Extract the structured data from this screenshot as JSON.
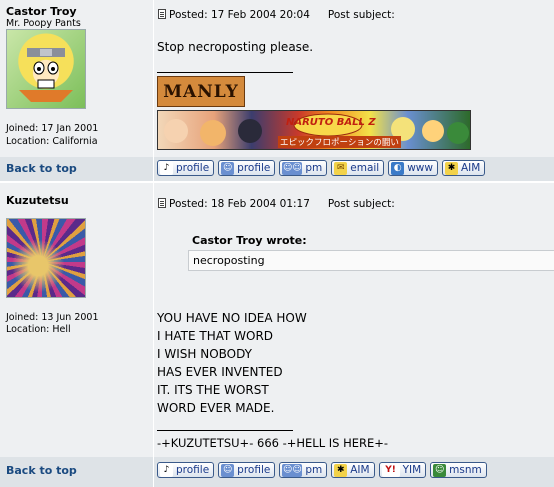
{
  "posts": [
    {
      "author": "Castor Troy",
      "rank": "Mr. Poopy Pants",
      "joined": "Joined: 17 Jan 2001",
      "location": "Location: California",
      "posted": "Posted: 17 Feb 2004 20:04",
      "subject": "Post subject:",
      "message": "Stop necroposting please.",
      "sig_banner1": "MANLY",
      "sig_banner2_text": "NARUTO BALL Z",
      "sig_banner2_sub": "エピックフロポーションの闘い",
      "back_to_top": "Back to top",
      "buttons": [
        "profile",
        "profile",
        "pm",
        "email",
        "www",
        "AIM"
      ]
    },
    {
      "author": "Kuzutetsu",
      "joined": "Joined: 13 Jun 2001",
      "location": "Location: Hell",
      "posted": "Posted: 18 Feb 2004 01:17",
      "subject": "Post subject:",
      "quote_author": "Castor Troy wrote:",
      "quote_text": "necroposting",
      "message_lines": [
        "YOU HAVE NO IDEA HOW",
        "I HATE THAT WORD",
        "I WISH NOBODY",
        "HAS EVER INVENTED",
        "IT. ITS THE WORST",
        "WORD EVER MADE."
      ],
      "signature": "-+KUZUTETSU+- 666 -+HELL IS HERE+-",
      "back_to_top": "Back to top",
      "buttons": [
        "profile",
        "profile",
        "pm",
        "AIM",
        "YIM",
        "msnm"
      ]
    }
  ],
  "colors": {
    "row1": "#eef0f2",
    "row2": "#dee3e7",
    "link": "#1a4a80"
  }
}
